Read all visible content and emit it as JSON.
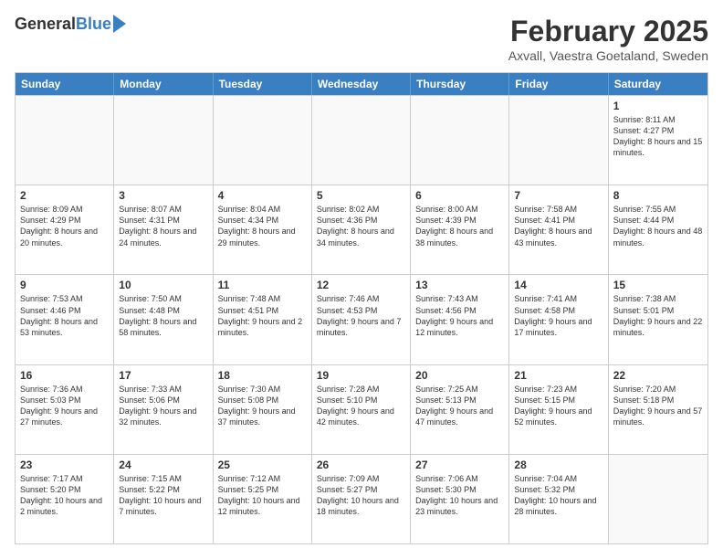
{
  "header": {
    "logo_general": "General",
    "logo_blue": "Blue",
    "title": "February 2025",
    "subtitle": "Axvall, Vaestra Goetaland, Sweden"
  },
  "days": [
    "Sunday",
    "Monday",
    "Tuesday",
    "Wednesday",
    "Thursday",
    "Friday",
    "Saturday"
  ],
  "weeks": [
    [
      {
        "num": "",
        "text": "",
        "empty": true
      },
      {
        "num": "",
        "text": "",
        "empty": true
      },
      {
        "num": "",
        "text": "",
        "empty": true
      },
      {
        "num": "",
        "text": "",
        "empty": true
      },
      {
        "num": "",
        "text": "",
        "empty": true
      },
      {
        "num": "",
        "text": "",
        "empty": true
      },
      {
        "num": "1",
        "text": "Sunrise: 8:11 AM\nSunset: 4:27 PM\nDaylight: 8 hours and 15 minutes.",
        "empty": false
      }
    ],
    [
      {
        "num": "2",
        "text": "Sunrise: 8:09 AM\nSunset: 4:29 PM\nDaylight: 8 hours and 20 minutes.",
        "empty": false
      },
      {
        "num": "3",
        "text": "Sunrise: 8:07 AM\nSunset: 4:31 PM\nDaylight: 8 hours and 24 minutes.",
        "empty": false
      },
      {
        "num": "4",
        "text": "Sunrise: 8:04 AM\nSunset: 4:34 PM\nDaylight: 8 hours and 29 minutes.",
        "empty": false
      },
      {
        "num": "5",
        "text": "Sunrise: 8:02 AM\nSunset: 4:36 PM\nDaylight: 8 hours and 34 minutes.",
        "empty": false
      },
      {
        "num": "6",
        "text": "Sunrise: 8:00 AM\nSunset: 4:39 PM\nDaylight: 8 hours and 38 minutes.",
        "empty": false
      },
      {
        "num": "7",
        "text": "Sunrise: 7:58 AM\nSunset: 4:41 PM\nDaylight: 8 hours and 43 minutes.",
        "empty": false
      },
      {
        "num": "8",
        "text": "Sunrise: 7:55 AM\nSunset: 4:44 PM\nDaylight: 8 hours and 48 minutes.",
        "empty": false
      }
    ],
    [
      {
        "num": "9",
        "text": "Sunrise: 7:53 AM\nSunset: 4:46 PM\nDaylight: 8 hours and 53 minutes.",
        "empty": false
      },
      {
        "num": "10",
        "text": "Sunrise: 7:50 AM\nSunset: 4:48 PM\nDaylight: 8 hours and 58 minutes.",
        "empty": false
      },
      {
        "num": "11",
        "text": "Sunrise: 7:48 AM\nSunset: 4:51 PM\nDaylight: 9 hours and 2 minutes.",
        "empty": false
      },
      {
        "num": "12",
        "text": "Sunrise: 7:46 AM\nSunset: 4:53 PM\nDaylight: 9 hours and 7 minutes.",
        "empty": false
      },
      {
        "num": "13",
        "text": "Sunrise: 7:43 AM\nSunset: 4:56 PM\nDaylight: 9 hours and 12 minutes.",
        "empty": false
      },
      {
        "num": "14",
        "text": "Sunrise: 7:41 AM\nSunset: 4:58 PM\nDaylight: 9 hours and 17 minutes.",
        "empty": false
      },
      {
        "num": "15",
        "text": "Sunrise: 7:38 AM\nSunset: 5:01 PM\nDaylight: 9 hours and 22 minutes.",
        "empty": false
      }
    ],
    [
      {
        "num": "16",
        "text": "Sunrise: 7:36 AM\nSunset: 5:03 PM\nDaylight: 9 hours and 27 minutes.",
        "empty": false
      },
      {
        "num": "17",
        "text": "Sunrise: 7:33 AM\nSunset: 5:06 PM\nDaylight: 9 hours and 32 minutes.",
        "empty": false
      },
      {
        "num": "18",
        "text": "Sunrise: 7:30 AM\nSunset: 5:08 PM\nDaylight: 9 hours and 37 minutes.",
        "empty": false
      },
      {
        "num": "19",
        "text": "Sunrise: 7:28 AM\nSunset: 5:10 PM\nDaylight: 9 hours and 42 minutes.",
        "empty": false
      },
      {
        "num": "20",
        "text": "Sunrise: 7:25 AM\nSunset: 5:13 PM\nDaylight: 9 hours and 47 minutes.",
        "empty": false
      },
      {
        "num": "21",
        "text": "Sunrise: 7:23 AM\nSunset: 5:15 PM\nDaylight: 9 hours and 52 minutes.",
        "empty": false
      },
      {
        "num": "22",
        "text": "Sunrise: 7:20 AM\nSunset: 5:18 PM\nDaylight: 9 hours and 57 minutes.",
        "empty": false
      }
    ],
    [
      {
        "num": "23",
        "text": "Sunrise: 7:17 AM\nSunset: 5:20 PM\nDaylight: 10 hours and 2 minutes.",
        "empty": false
      },
      {
        "num": "24",
        "text": "Sunrise: 7:15 AM\nSunset: 5:22 PM\nDaylight: 10 hours and 7 minutes.",
        "empty": false
      },
      {
        "num": "25",
        "text": "Sunrise: 7:12 AM\nSunset: 5:25 PM\nDaylight: 10 hours and 12 minutes.",
        "empty": false
      },
      {
        "num": "26",
        "text": "Sunrise: 7:09 AM\nSunset: 5:27 PM\nDaylight: 10 hours and 18 minutes.",
        "empty": false
      },
      {
        "num": "27",
        "text": "Sunrise: 7:06 AM\nSunset: 5:30 PM\nDaylight: 10 hours and 23 minutes.",
        "empty": false
      },
      {
        "num": "28",
        "text": "Sunrise: 7:04 AM\nSunset: 5:32 PM\nDaylight: 10 hours and 28 minutes.",
        "empty": false
      },
      {
        "num": "",
        "text": "",
        "empty": true
      }
    ]
  ]
}
